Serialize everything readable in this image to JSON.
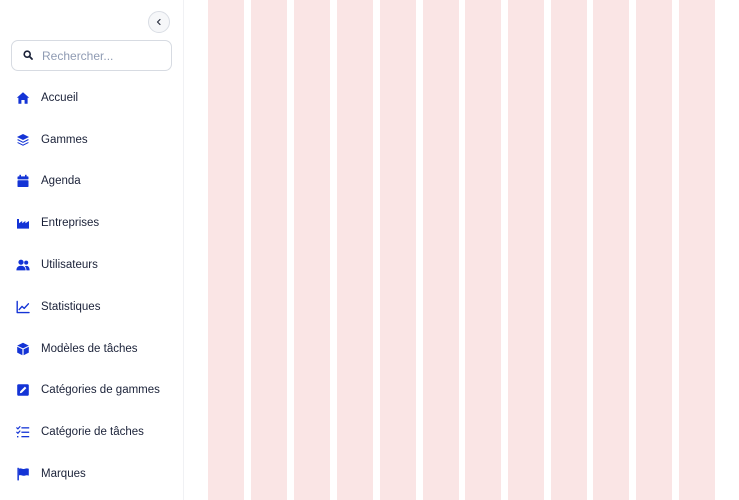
{
  "sidebar": {
    "collapse_icon": "chevron-left-icon",
    "search": {
      "placeholder": "Rechercher...",
      "value": "",
      "icon": "search-icon"
    },
    "items": [
      {
        "label": "Accueil",
        "icon": "home-icon"
      },
      {
        "label": "Gammes",
        "icon": "layers-icon"
      },
      {
        "label": "Agenda",
        "icon": "calendar-icon"
      },
      {
        "label": "Entreprises",
        "icon": "factory-icon"
      },
      {
        "label": "Utilisateurs",
        "icon": "users-icon"
      },
      {
        "label": "Statistiques",
        "icon": "chart-line-icon"
      },
      {
        "label": "Modèles de tâches",
        "icon": "cube-icon"
      },
      {
        "label": "Catégories de gammes",
        "icon": "edit-square-icon"
      },
      {
        "label": "Catégorie de tâches",
        "icon": "checklist-icon"
      },
      {
        "label": "Marques",
        "icon": "flag-icon"
      }
    ]
  },
  "colors": {
    "accent": "#1434d6",
    "text": "#1a2138",
    "placeholder": "#8f9bb3",
    "grid_column": "#fae5e5"
  },
  "layout_grid": {
    "column_count": 12
  }
}
